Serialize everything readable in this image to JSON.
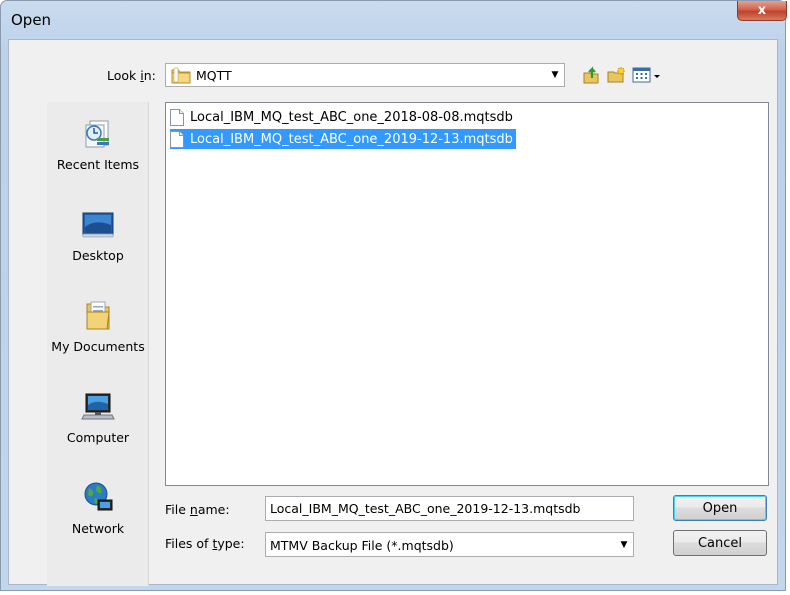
{
  "window": {
    "title": "Open",
    "close_glyph": "x"
  },
  "lookin": {
    "label_pre": "Look ",
    "label_u": "i",
    "label_post": "n:",
    "value": "MQTT"
  },
  "toolbar": {
    "icons": [
      "up-folder-icon",
      "new-folder-icon",
      "view-menu-icon"
    ]
  },
  "places": [
    {
      "label": "Recent Items",
      "icon": "recent-items-icon"
    },
    {
      "label": "Desktop",
      "icon": "desktop-icon"
    },
    {
      "label": "My Documents",
      "icon": "my-documents-icon"
    },
    {
      "label": "Computer",
      "icon": "computer-icon"
    },
    {
      "label": "Network",
      "icon": "network-icon"
    }
  ],
  "files": [
    {
      "name": "Local_IBM_MQ_test_ABC_one_2018-08-08.mqtsdb",
      "selected": false
    },
    {
      "name": "Local_IBM_MQ_test_ABC_one_2019-12-13.mqtsdb",
      "selected": true
    }
  ],
  "filename": {
    "label_pre": "File ",
    "label_u": "n",
    "label_post": "ame:",
    "value": "Local_IBM_MQ_test_ABC_one_2019-12-13.mqtsdb"
  },
  "filetype": {
    "label_pre": "Files of ",
    "label_u": "t",
    "label_post": "ype:",
    "value": "MTMV Backup File (*.mqtsdb)"
  },
  "buttons": {
    "open": "Open",
    "cancel": "Cancel"
  },
  "colors": {
    "selection": "#3399ff",
    "title_bar": "#c9dbef",
    "close": "#c0412a"
  }
}
